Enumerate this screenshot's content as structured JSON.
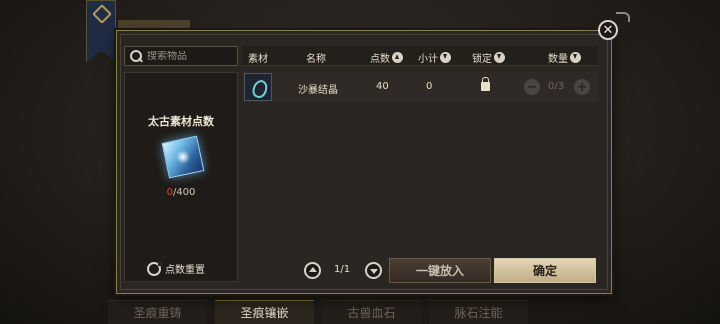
{
  "search": {
    "placeholder": "搜索物品"
  },
  "left_panel": {
    "title": "太古素材点数",
    "points_current": "0",
    "points_max": "/400",
    "reset_label": "点数重置"
  },
  "table": {
    "headers": {
      "material": "素材",
      "name": "名称",
      "points": "点数",
      "subtotal": "小计",
      "lock": "锁定",
      "quantity": "数量"
    },
    "rows": [
      {
        "name": "沙暴结晶",
        "points": "40",
        "subtotal": "0",
        "quantity": "0/3"
      }
    ]
  },
  "pager": {
    "indicator": "1/1"
  },
  "buttons": {
    "auto_place": "一键放入",
    "confirm": "确定"
  },
  "bottom_tabs": [
    "圣痕重铸",
    "圣痕镶嵌",
    "古兽血石",
    "脉石注能"
  ],
  "colors": {
    "accent_gold": "#bfae86",
    "points_current": "#e0443a"
  }
}
